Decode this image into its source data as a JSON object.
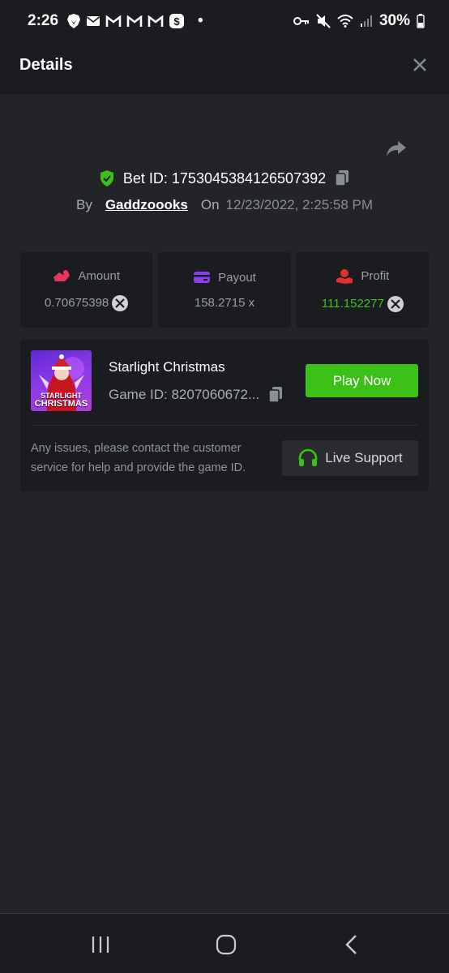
{
  "status_bar": {
    "time": "2:26",
    "battery": "30%",
    "dot": "•",
    "left_icons": [
      "brave-icon",
      "mail-icon",
      "gmail-icon",
      "gmail-icon",
      "gmail-icon",
      "cashapp-icon"
    ],
    "right_icons": [
      "key-icon",
      "mute-icon",
      "wifi-icon",
      "signal-icon",
      "battery-icon"
    ]
  },
  "header": {
    "title": "Details"
  },
  "bet": {
    "bet_id_label": "Bet ID:",
    "bet_id": "1753045384126507392",
    "by_label": "By",
    "username": "Gaddzoooks",
    "on_label": "On",
    "datetime": "12/23/2022, 2:25:58 PM"
  },
  "stats": [
    {
      "label": "Amount",
      "value": "0.70675398",
      "color": "#e8355e"
    },
    {
      "label": "Payout",
      "value": "158.2715 x",
      "color": "#8b3df0"
    },
    {
      "label": "Profit",
      "value": "111.152277",
      "color": "#e3312f"
    }
  ],
  "game": {
    "name": "Starlight Christmas",
    "id_text": "Game ID: 8207060672...",
    "thumb_line1": "STARLIGHT",
    "thumb_line2": "CHRISTMAS",
    "play_label": "Play Now",
    "help_text": "Any issues, please contact the customer service for help and provide the game ID.",
    "support_label": "Live Support"
  },
  "colors": {
    "accent_green": "#3bc117",
    "profit_green": "#43c21a",
    "background": "#232427",
    "card": "#1b1c1f"
  }
}
